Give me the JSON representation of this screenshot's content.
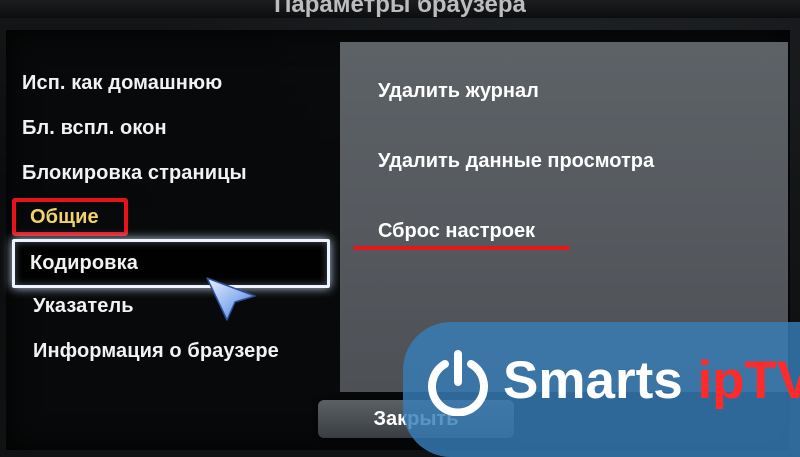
{
  "header": {
    "title": "Параметры браузера"
  },
  "menu": {
    "items": [
      {
        "label": "Исп. как домашнюю"
      },
      {
        "label": "Бл. вспл. окон"
      },
      {
        "label": "Блокировка страницы"
      },
      {
        "label": "Общие"
      },
      {
        "label": "Кодировка"
      },
      {
        "label": "Указатель"
      },
      {
        "label": "Информация о браузере"
      }
    ]
  },
  "options": {
    "items": [
      {
        "label": "Удалить журнал"
      },
      {
        "label": "Удалить данные просмотра"
      },
      {
        "label": "Сброс настроек"
      }
    ]
  },
  "footer": {
    "close_label": "Закрыть"
  },
  "watermark": {
    "text": "Smarts",
    "brand": "ipTV"
  },
  "icons": {
    "cursor": "pointer-arrow-icon",
    "power": "power-icon"
  },
  "colors": {
    "annotation_red": "#e5141a",
    "highlight_yellow": "#f1d36a",
    "watermark_blue": "#377eb8"
  }
}
